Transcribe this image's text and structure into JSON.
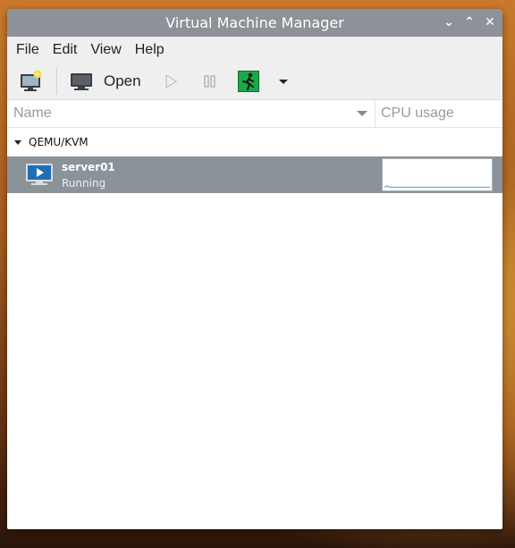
{
  "window": {
    "title": "Virtual Machine Manager",
    "controls": [
      {
        "name": "minimize-icon",
        "glyph": "⌄"
      },
      {
        "name": "maximize-icon",
        "glyph": "⌃"
      },
      {
        "name": "close-icon",
        "glyph": "✕"
      }
    ]
  },
  "menu": [
    "File",
    "Edit",
    "View",
    "Help"
  ],
  "toolbar": {
    "new_icon": "new-vm-icon",
    "open_label": "Open",
    "run_icon": "play-icon",
    "pause_icon": "pause-icon",
    "shutdown_icon": "shutdown-icon",
    "menu_icon": "dropdown-arrow-icon"
  },
  "columns": {
    "name": "Name",
    "cpu": "CPU usage"
  },
  "connection": {
    "label": "QEMU/KVM"
  },
  "vms": [
    {
      "name": "server01",
      "status": "Running",
      "cpu_usage_fraction": 0.02
    }
  ],
  "colors": {
    "selection": "#8a939a",
    "titlebar": "#8c9297",
    "cpu_line": "#6aa6c8",
    "shutdown_bg": "#19a84a"
  }
}
